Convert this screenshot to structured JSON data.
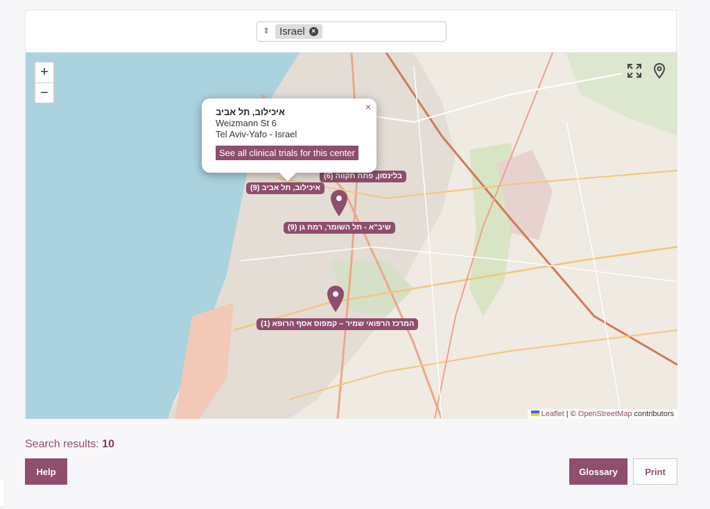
{
  "filter": {
    "caret_icon": "updown-caret-icon",
    "selected_country": "Israel",
    "remove_icon": "close-circle-icon"
  },
  "map": {
    "zoom_in": "+",
    "zoom_out": "−",
    "fullscreen_icon": "fullscreen-icon",
    "locate_icon": "map-pin-icon",
    "popup": {
      "close": "×",
      "center_name": "איכילוב, תל אביב",
      "address_line1": "Weizmann St 6",
      "address_line2": "Tel Aviv-Yafo - Israel",
      "button": "See all clinical trials for this center"
    },
    "labels": [
      "בלינסון, פתח תקווה (6)",
      "איכילוב, תל אביב (9)",
      "שיב\"א - תל השומר, רמת גן (9)",
      "המרכז הרפואי שמיר – קמפוס אסף הרופא (1)"
    ],
    "attribution": {
      "leaflet": "Leaflet",
      "separator": "| ©",
      "osm": "OpenStreetMap",
      "contributors": "contributors"
    },
    "colors": {
      "accent": "#8e4e6c",
      "sea": "#aad3df",
      "land": "#efeae2"
    }
  },
  "results": {
    "label": "Search results:",
    "count": "10"
  },
  "buttons": {
    "help": "Help",
    "glossary": "Glossary",
    "print": "Print"
  }
}
